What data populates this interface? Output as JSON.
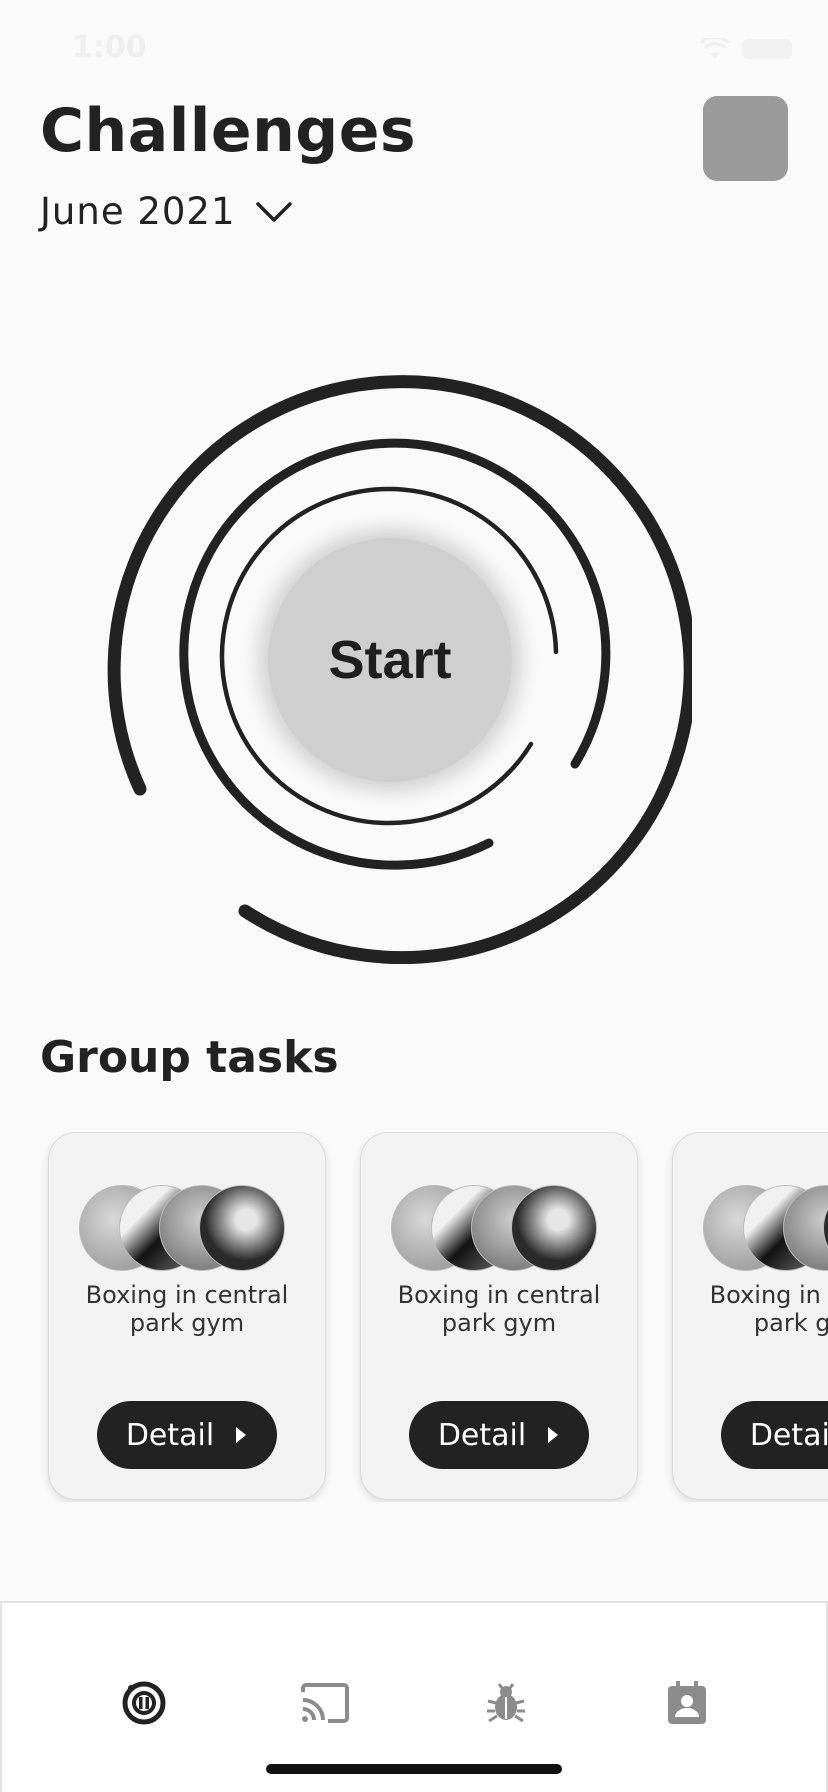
{
  "status": {
    "time": "1:00"
  },
  "header": {
    "title": "Challenges",
    "month": "June 2021"
  },
  "main": {
    "start_label": "Start"
  },
  "group": {
    "title": "Group tasks",
    "cards": [
      {
        "line1": "Boxing in central",
        "line2": "park gym",
        "button": "Detail"
      },
      {
        "line1": "Boxing in central",
        "line2": "park gym",
        "button": "Detail"
      },
      {
        "line1": "Boxing in central",
        "line2": "park gym",
        "button": "Detail"
      }
    ]
  },
  "tabbar": {
    "items": [
      {
        "icon": "activity-ring-icon",
        "active": true
      },
      {
        "icon": "cast-icon",
        "active": false
      },
      {
        "icon": "bug-icon",
        "active": false
      },
      {
        "icon": "contact-icon",
        "active": false
      }
    ]
  },
  "colors": {
    "active_icon": "#222222",
    "inactive_icon": "#8c8c8c",
    "button_bg": "#222222"
  }
}
